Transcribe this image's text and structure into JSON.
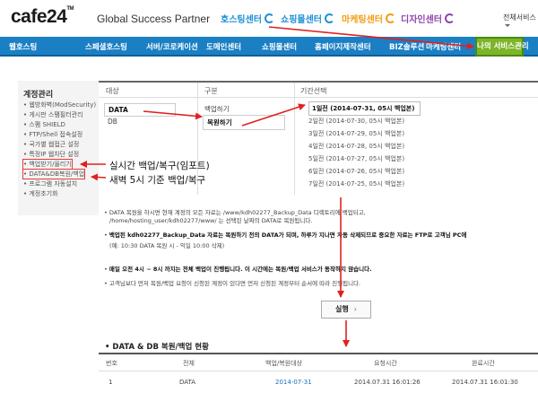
{
  "header": {
    "logo": "cafe24",
    "logo_tm": "TM",
    "tagline": "Global Success Partner",
    "centers": [
      {
        "label": "호스팅센터",
        "color": "#1e8fd6"
      },
      {
        "label": "쇼핑몰센터",
        "color": "#1e8fd6"
      },
      {
        "label": "마케팅센터",
        "color": "#f39c12"
      },
      {
        "label": "디자인센터",
        "color": "#8e44ad"
      }
    ],
    "all_services": "전체서비스"
  },
  "mainnav": {
    "items": [
      "웹호스팅",
      "스페셜호스팅",
      "서버/코로케이션",
      "도메인센터",
      "쇼핑몰센터",
      "홈페이지제작센터",
      "BIZ솔루션",
      "마케팅센터"
    ],
    "active": "나의 서비스관리",
    "bg_color": "#1b7fc4",
    "active_color": "#7cb527"
  },
  "sidebar": {
    "title": "계정관리",
    "items": [
      "웹방화벽(ModSecurity)",
      "게시판 스팸필터관리",
      "스팸 SHIELD",
      "FTP/Shell 접속설정",
      "국가별 웹접근 설정",
      "특정IP 웹차단 설정",
      "백업받기/올리기",
      "DATA&DB복원/백업",
      "프로그램 자동설치",
      "계정초기화"
    ]
  },
  "select_table": {
    "headers": [
      "대상",
      "구분",
      "기간선택"
    ],
    "targets": [
      "DATA",
      "DB"
    ],
    "types": [
      "백업하기",
      "복원하기"
    ],
    "periods": [
      "1일전 (2014-07-31, 05시 백업본)",
      "2일전 (2014-07-30, 05시 백업본)",
      "3일전 (2014-07-29, 05시 백업본)",
      "4일전 (2014-07-28, 05시 백업본)",
      "5일전 (2014-07-27, 05시 백업본)",
      "6일전 (2014-07-26, 05시 백업본)",
      "7일전 (2014-07-25, 05시 백업본)"
    ]
  },
  "notice": {
    "line1": "DATA 복원을 하시면 현재 계정의 모든 자료는 /www/kdh02277_Backup_Data 디렉토리에 백업되고,",
    "line2": "/home/hosting_user/kdh02277/www/ 는 선택된 날짜의 DATA로 복원됩니다.",
    "line3": "백업된 kdh02277_Backup_Data 자료는 복원하기 전의 DATA가 되며, 하루가 지나면 자동 삭제되므로 중요한 자료는 FTP로 고객님 PC에",
    "line4": "(예: 10:30 DATA 복원 시 - 익일 10:00 삭제)",
    "line5": "매일 오전 4시 ~ 8시 까지는 전체 백업이 진행됩니다. 이 시간에는 복원/백업 서비스가 동작하지 않습니다.",
    "line6": "고객님보다 먼저 복원/백업 요청이 신청된 계정이 있다면 먼저 신청된 계정부터 순서에 따라 진행됩니다."
  },
  "run_button": {
    "label": "실행",
    "chevron": "›"
  },
  "status": {
    "title": "DATA & DB 복원/백업 현황",
    "headers": [
      "번호",
      "전체",
      "백업/복원대상",
      "요청시간",
      "완료시간"
    ],
    "row": [
      "1",
      "DATA",
      "2014-07-31",
      "2014.07.31 16:01:26",
      "2014.07.31 16:01:30"
    ]
  },
  "annotations": {
    "realtime": "실시간 백업/복구(임포트)",
    "dawn": "새벽 5시 기준 백업/복구",
    "arrow_color": "#e02020"
  }
}
